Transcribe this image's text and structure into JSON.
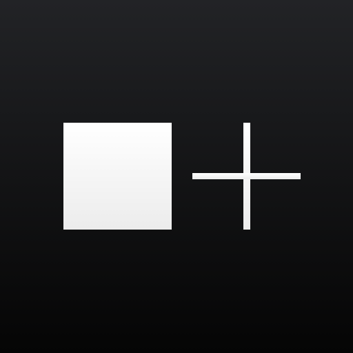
{
  "icon": {
    "description_name": "app-icon",
    "glyphs": [
      "square-icon",
      "plus-icon"
    ],
    "colors": {
      "background_top": "#222326",
      "background_bottom": "#050505",
      "glyph_top": "#ffffff",
      "glyph_bottom": "#ececec"
    }
  }
}
